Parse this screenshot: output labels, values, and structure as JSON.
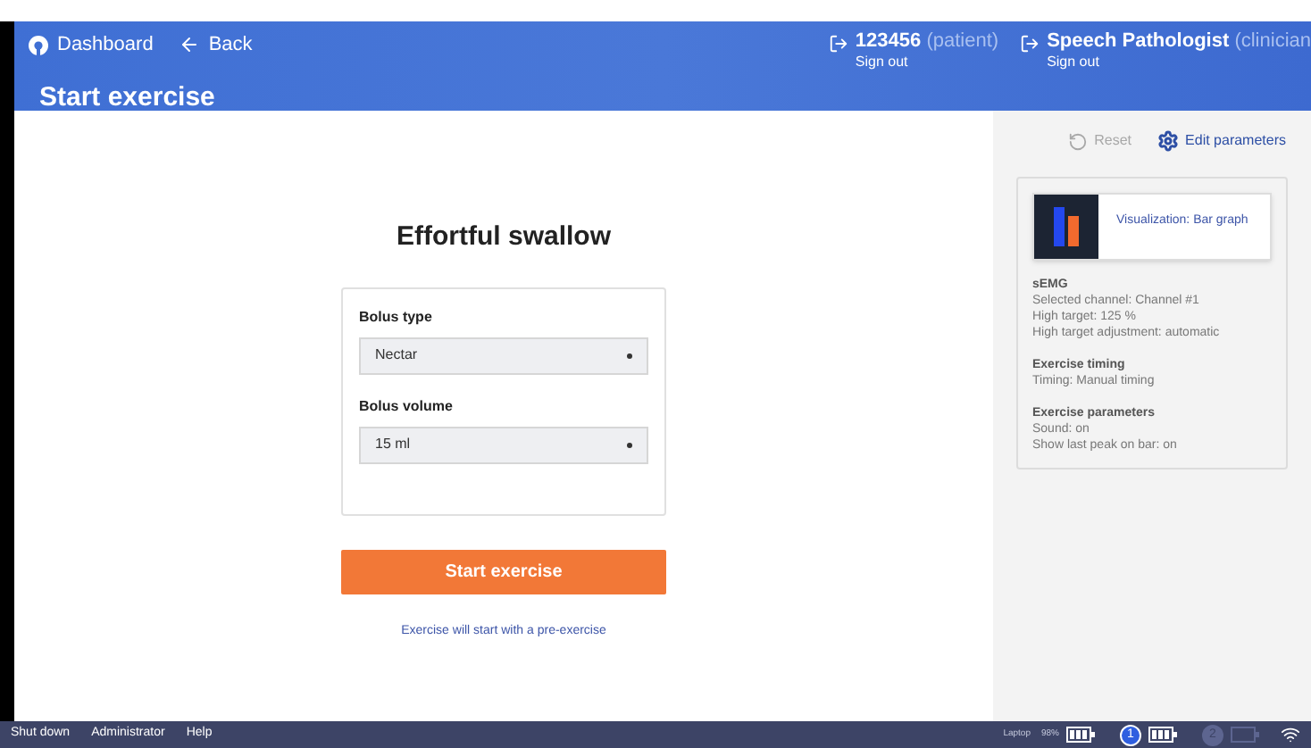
{
  "header": {
    "nav": [
      {
        "kind": "home",
        "label": "Dashboard"
      },
      {
        "kind": "back",
        "label": "Back"
      }
    ],
    "title": "Start exercise",
    "users": [
      {
        "name": "123456",
        "role": "(patient)",
        "action": "Sign out"
      },
      {
        "name": "Speech Pathologist",
        "role": "(clinician",
        "action": "Sign out"
      }
    ]
  },
  "exercise": {
    "title": "Effortful swallow",
    "fields": [
      {
        "label": "Bolus type",
        "value": "Nectar"
      },
      {
        "label": "Bolus volume",
        "value": "15 ml"
      }
    ],
    "start_button": "Start exercise",
    "note": "Exercise will start with a pre-exercise"
  },
  "side_panel": {
    "actions": [
      {
        "kind": "reset",
        "label": "Reset",
        "disabled": true
      },
      {
        "kind": "edit",
        "label": "Edit parameters",
        "disabled": false
      }
    ],
    "visualization": "Visualization: Bar graph",
    "sections": [
      {
        "title": "sEMG",
        "lines": [
          "Selected channel: Channel #1",
          "High target: 125 %",
          "High target adjustment: automatic"
        ]
      },
      {
        "title": "Exercise timing",
        "lines": [
          "Timing: Manual timing"
        ]
      },
      {
        "title": "Exercise parameters",
        "lines": [
          "Sound: on",
          "Show last peak on bar: on"
        ]
      }
    ]
  },
  "status_bar": {
    "links": [
      "Shut down",
      "Administrator",
      "Help"
    ],
    "device_label": "Laptop",
    "battery": "98%",
    "sensors": [
      {
        "label": "1",
        "active": true
      },
      {
        "label": "2",
        "active": false
      }
    ]
  }
}
